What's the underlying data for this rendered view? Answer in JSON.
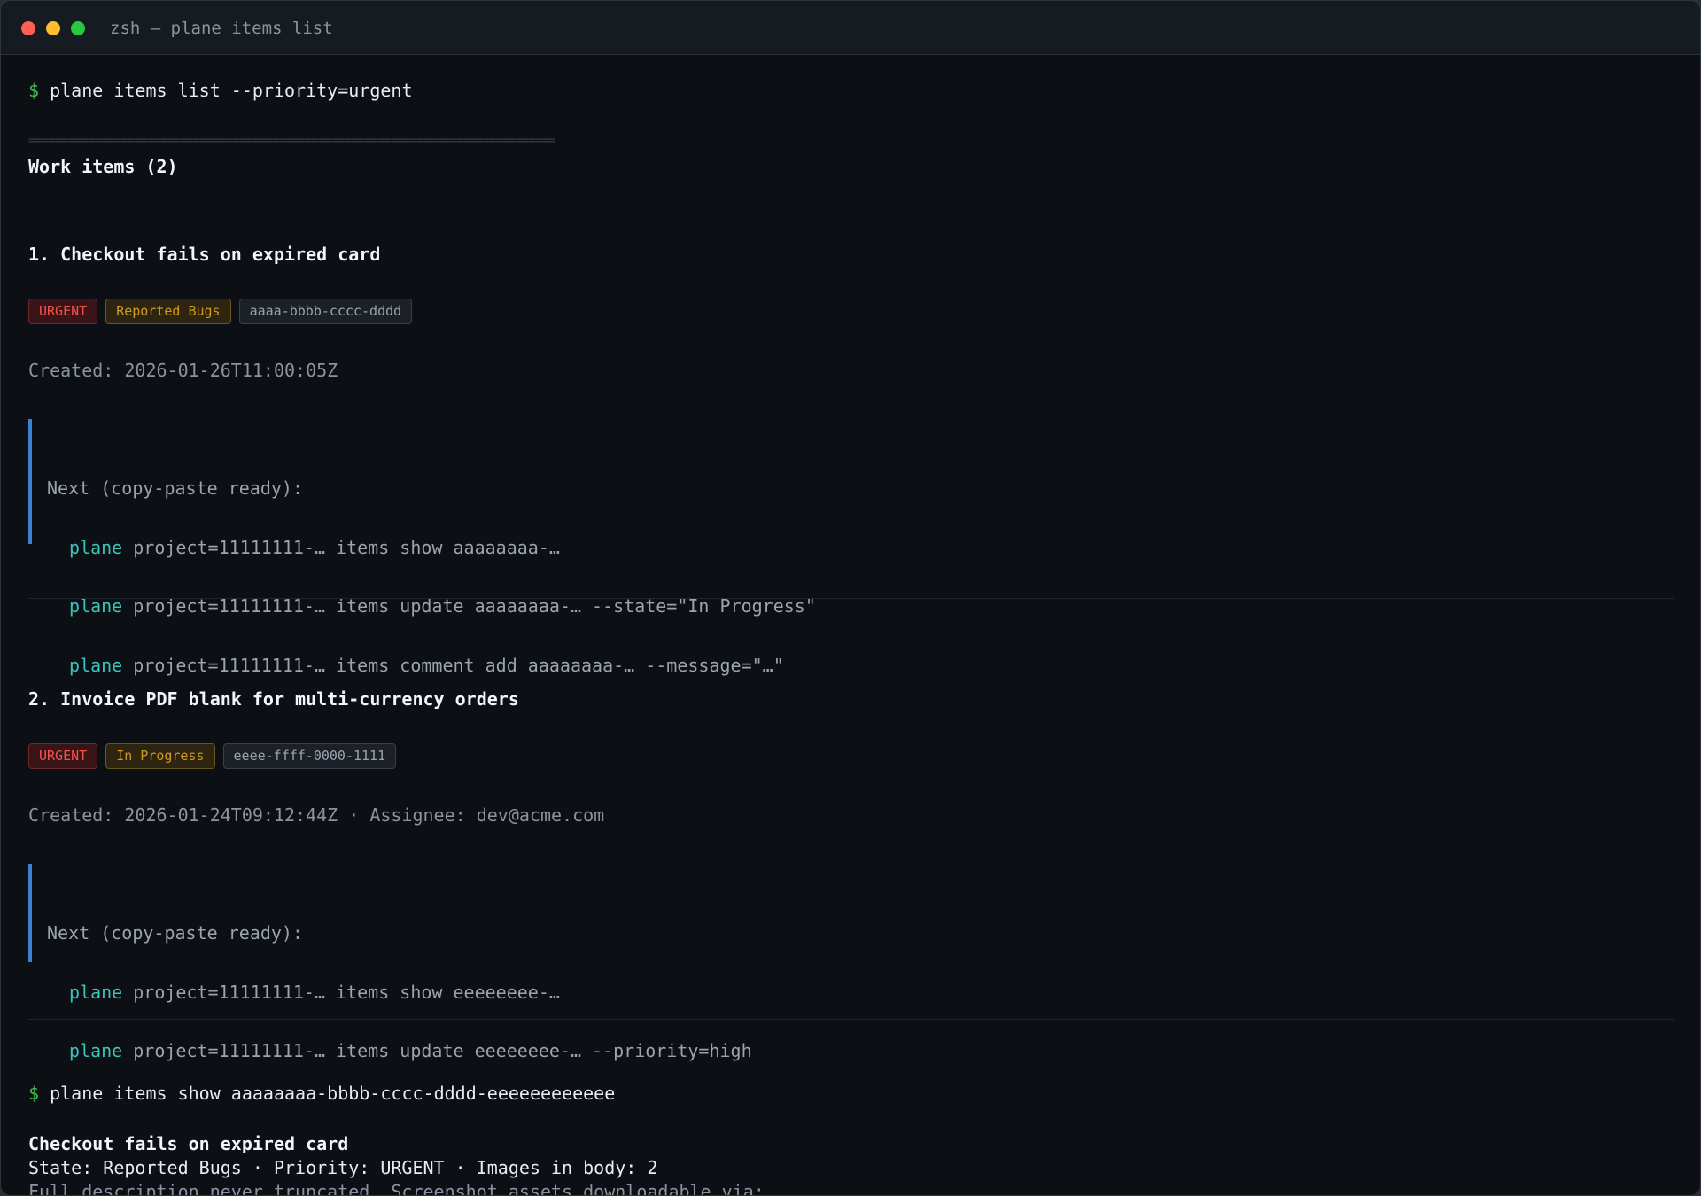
{
  "window": {
    "title": "zsh — plane items list",
    "traffic_lights": [
      "close",
      "minimize",
      "maximize"
    ],
    "colors": {
      "close": "#ff5f57",
      "minimize": "#febc2e",
      "maximize": "#28c840"
    }
  },
  "prompt_symbol": "$",
  "command1": "plane items list --priority=urgent",
  "separator": "================================================================================",
  "list_heading": "Work items (2)",
  "items": [
    {
      "title": "1. Checkout fails on expired card",
      "badges": {
        "priority": "URGENT",
        "state": "Reported Bugs",
        "id": "aaaa-bbbb-cccc-dddd"
      },
      "meta": "Created: 2026-01-26T11:00:05Z",
      "next_label": "Next (copy-paste ready):",
      "next_cmds": [
        {
          "kw": "plane",
          "rest": " project=11111111-… items show aaaaaaaa-…"
        },
        {
          "kw": "plane",
          "rest": " project=11111111-… items update aaaaaaaa-… --state=\"In Progress\""
        },
        {
          "kw": "plane",
          "rest": " project=11111111-… items comment add aaaaaaaa-… --message=\"…\""
        }
      ]
    },
    {
      "title": "2. Invoice PDF blank for multi-currency orders",
      "badges": {
        "priority": "URGENT",
        "state": "In Progress",
        "id": "eeee-ffff-0000-1111"
      },
      "meta": "Created: 2026-01-24T09:12:44Z · Assignee: dev@acme.com",
      "next_label": "Next (copy-paste ready):",
      "next_cmds": [
        {
          "kw": "plane",
          "rest": " project=11111111-… items show eeeeeeee-…"
        },
        {
          "kw": "plane",
          "rest": " project=11111111-… items update eeeeeeee-… --priority=high"
        }
      ]
    }
  ],
  "command2": "plane items show aaaaaaaa-bbbb-cccc-dddd-eeeeeeeeeeee",
  "detail": {
    "title": "Checkout fails on expired card",
    "state_line": "State: Reported Bugs · Priority: URGENT · Images in body: 2",
    "desc_line": "Full description never truncated. Screenshot assets downloadable via:"
  },
  "colors": {
    "background": "#0c0f14",
    "prompt": "#3fb950",
    "keyword": "#39c5bb",
    "urgent": "#f85149",
    "state": "#d29922",
    "accent_bar": "#3b82d6"
  }
}
